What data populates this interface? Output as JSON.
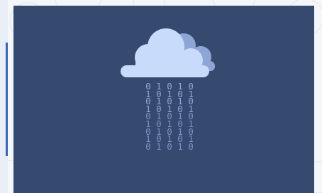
{
  "illustration": {
    "icon": "cloud-binary-rain-icon",
    "colors": {
      "panel": "#354a6e",
      "cloud_front": "#c8dbfb",
      "cloud_back": "#8ea6d6",
      "digits": "#8ea6d6"
    },
    "rain_rows": [
      "0 1 0 1 0",
      "1 0 1 0 1",
      "0 1 0 1 0",
      "1 0 1 0 1",
      "0 1 0 1 0",
      "1 0 1 0 1",
      "0 1 0 1 0",
      "1 0 1 0 1",
      "0 1 0 1 0"
    ]
  }
}
